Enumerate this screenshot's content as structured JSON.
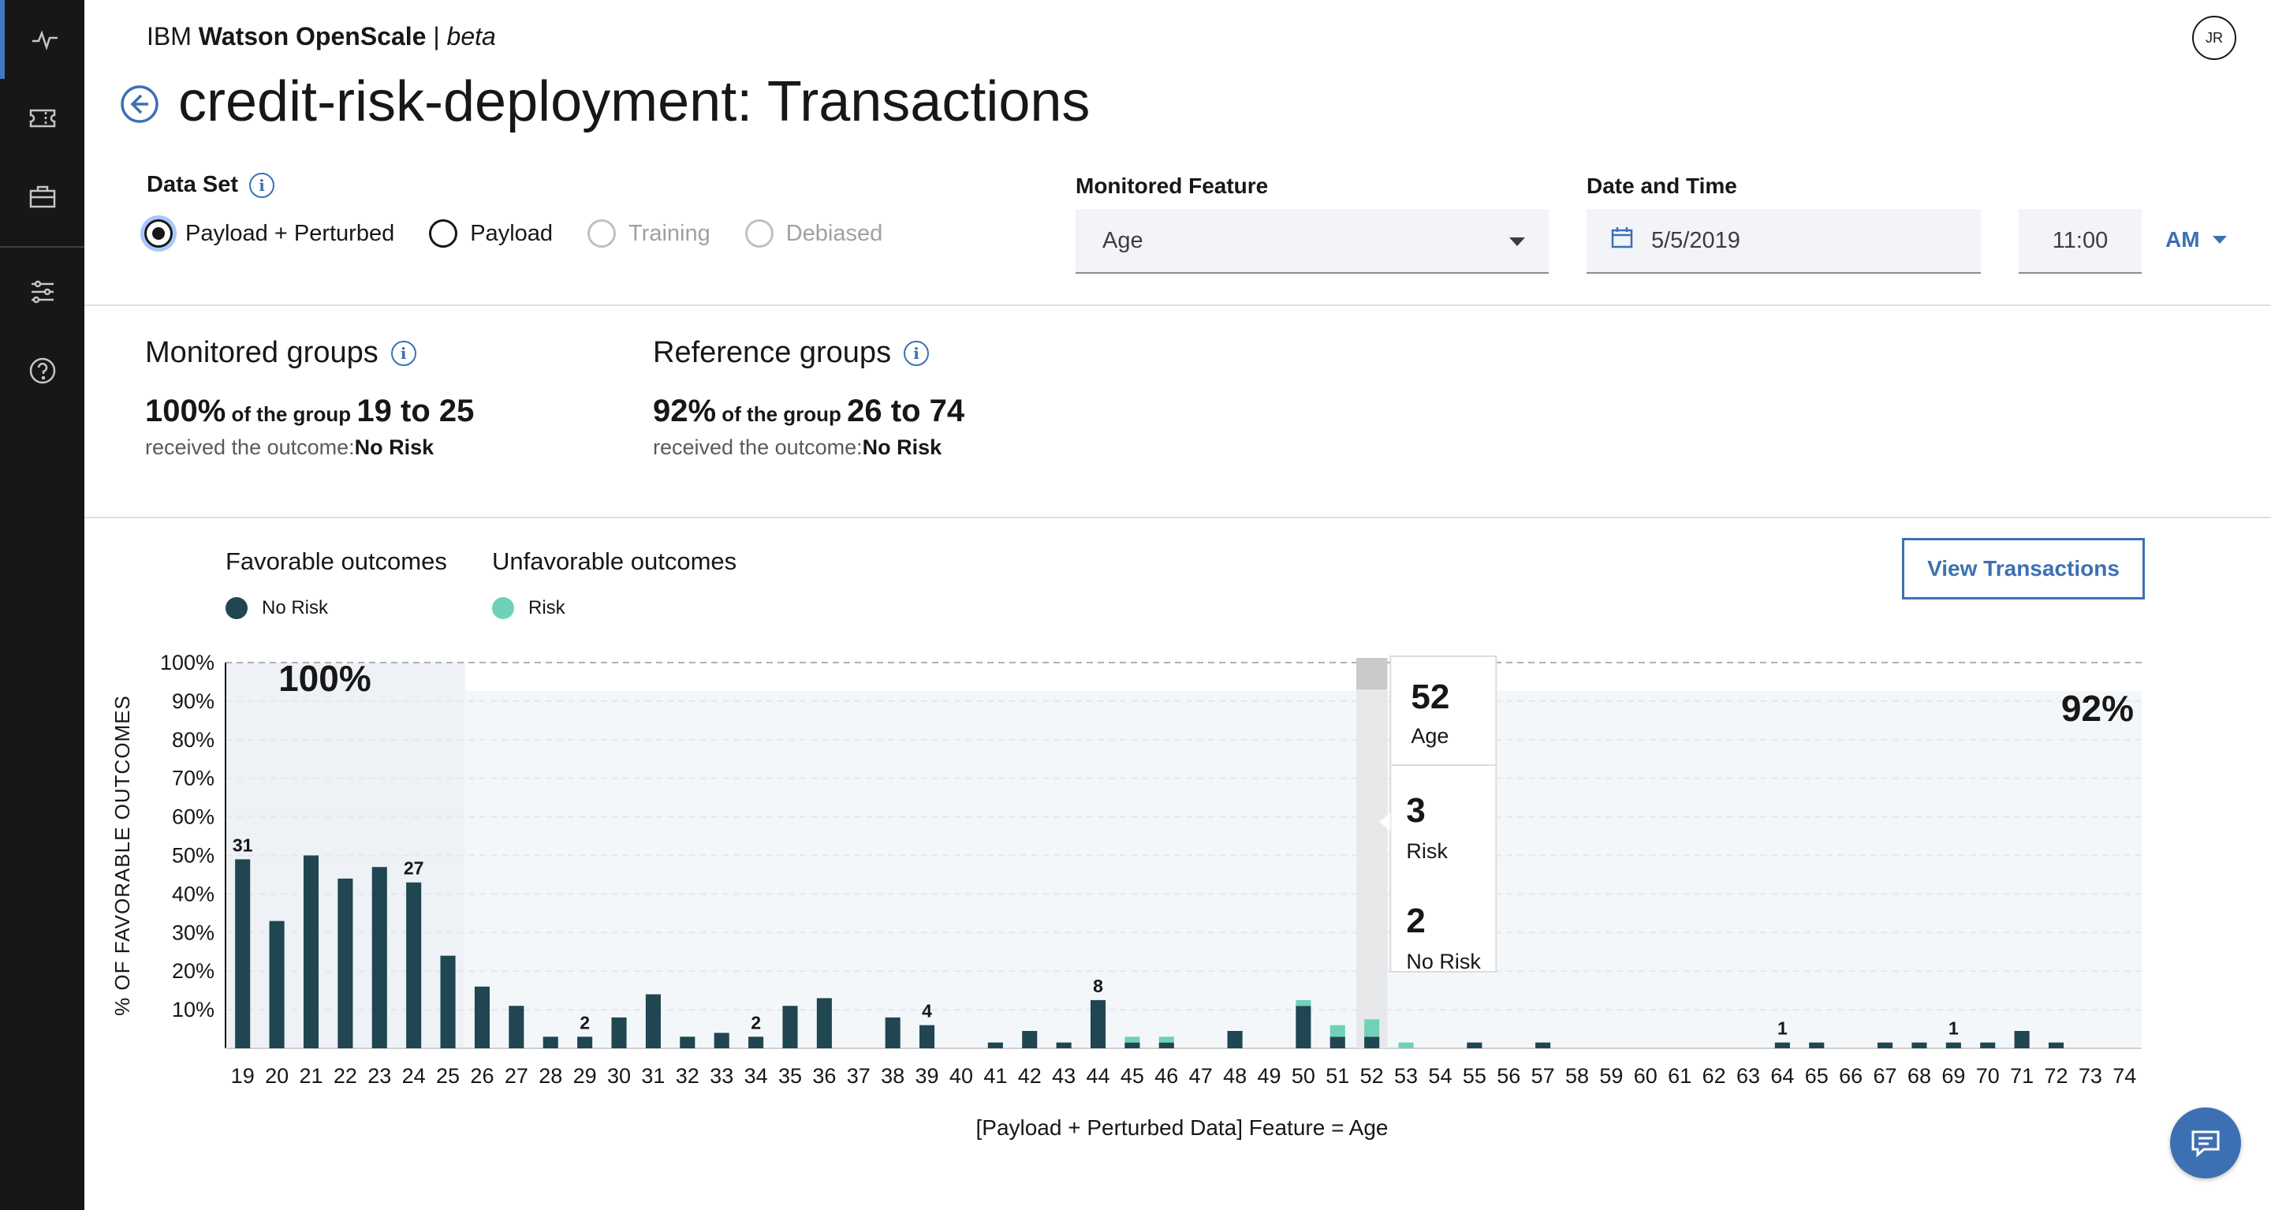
{
  "app": {
    "brand_prefix": "IBM ",
    "brand_name": "Watson OpenScale",
    "brand_sep": " | ",
    "brand_tag": "beta",
    "avatar": "JR"
  },
  "nav": {
    "icons": [
      "activity-icon",
      "ticket-icon",
      "briefcase-icon",
      "sliders-icon",
      "help-icon"
    ]
  },
  "page": {
    "title": "credit-risk-deployment: Transactions"
  },
  "dataset": {
    "label": "Data Set",
    "options": [
      {
        "label": "Payload + Perturbed",
        "checked": true,
        "disabled": false
      },
      {
        "label": "Payload",
        "checked": false,
        "disabled": false
      },
      {
        "label": "Training",
        "checked": false,
        "disabled": true
      },
      {
        "label": "Debiased",
        "checked": false,
        "disabled": true
      }
    ]
  },
  "monitored_feature": {
    "label": "Monitored Feature",
    "value": "Age"
  },
  "date_time": {
    "label": "Date and Time",
    "date": "5/5/2019",
    "time": "11:00",
    "period": "AM"
  },
  "monitored_groups": {
    "title": "Monitored groups",
    "percent": "100%",
    "mid": " of the group ",
    "range": "19 to 25",
    "outcome_prefix": "received the outcome:",
    "outcome": "No Risk"
  },
  "reference_groups": {
    "title": "Reference groups",
    "percent": "92%",
    "mid": " of the group ",
    "range": "26 to 74",
    "outcome_prefix": "received the outcome:",
    "outcome": "No Risk"
  },
  "legend": {
    "favorable_title": "Favorable outcomes",
    "unfavorable_title": "Unfavorable outcomes",
    "favorable_item": "No Risk",
    "unfavorable_item": "Risk"
  },
  "actions": {
    "view_transactions": "View Transactions",
    "chat_icon": "chat-icon"
  },
  "colors": {
    "no_risk": "#1f4651",
    "risk": "#6fd2b7",
    "accent": "#3d70b2"
  },
  "chart_data": {
    "type": "bar",
    "ylabel": "% OF FAVORABLE OUTCOMES",
    "xlabel": "[Payload + Perturbed Data] Feature = Age",
    "ylim": [
      0,
      100
    ],
    "yticks": [
      "10%",
      "20%",
      "30%",
      "40%",
      "50%",
      "60%",
      "70%",
      "80%",
      "90%",
      "100%"
    ],
    "categories": [
      "19",
      "20",
      "21",
      "22",
      "23",
      "24",
      "25",
      "26",
      "27",
      "28",
      "29",
      "30",
      "31",
      "32",
      "33",
      "34",
      "35",
      "36",
      "37",
      "38",
      "39",
      "40",
      "41",
      "42",
      "43",
      "44",
      "45",
      "46",
      "47",
      "48",
      "49",
      "50",
      "51",
      "52",
      "53",
      "54",
      "55",
      "56",
      "57",
      "58",
      "59",
      "60",
      "61",
      "62",
      "63",
      "64",
      "65",
      "66",
      "67",
      "68",
      "69",
      "70",
      "71",
      "72",
      "73",
      "74"
    ],
    "series": [
      {
        "name": "No Risk",
        "values": [
          49,
          33,
          50,
          44,
          47,
          43,
          24,
          16,
          11,
          3,
          3,
          8,
          14,
          3,
          4,
          3,
          11,
          13,
          0,
          8,
          6,
          0,
          1.5,
          4.5,
          1.5,
          12.5,
          1.5,
          1.5,
          0,
          4.5,
          0,
          11,
          3,
          3,
          0,
          0,
          1.5,
          0,
          1.5,
          0,
          0,
          0,
          0,
          0,
          0,
          1.5,
          1.5,
          0,
          1.5,
          1.5,
          1.5,
          1.5,
          4.5,
          1.5,
          0,
          0
        ]
      },
      {
        "name": "Risk",
        "values": [
          0,
          0,
          0,
          0,
          0,
          0,
          0,
          0,
          0,
          0,
          0,
          0,
          0,
          0,
          0,
          0,
          0,
          0,
          0,
          0,
          0,
          0,
          0,
          0,
          0,
          0,
          1.5,
          1.5,
          0,
          0,
          0,
          1.5,
          3,
          4.5,
          1.5,
          0,
          0,
          0,
          0,
          0,
          0,
          0,
          0,
          0,
          0,
          0,
          0,
          0,
          0,
          0,
          0,
          0,
          0,
          0,
          0,
          0
        ]
      }
    ],
    "bar_labels": {
      "19": "31",
      "24": "27",
      "29": "2",
      "34": "2",
      "39": "4",
      "44": "8",
      "64": "1",
      "69": "1"
    },
    "group_annotations": {
      "monitored": "100%",
      "reference": "92%"
    },
    "tooltip": {
      "age": "52",
      "age_label": "Age",
      "risk": "3",
      "risk_label": "Risk",
      "no_risk": "2",
      "no_risk_label": "No Risk",
      "category": "52"
    }
  }
}
